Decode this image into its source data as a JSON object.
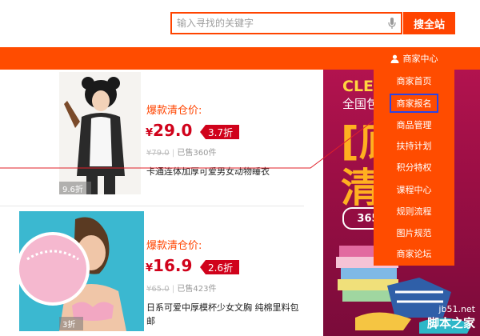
{
  "search": {
    "placeholder": "输入寻找的关键字",
    "button_label": "搜全站"
  },
  "nav": {
    "merchant_center_label": "商家中心",
    "dropdown_items": [
      "商家首页",
      "商家报名",
      "商品管理",
      "扶持计划",
      "积分特权",
      "课程中心",
      "规则流程",
      "图片规范",
      "商家论坛"
    ],
    "highlighted_item": "商家报名"
  },
  "products": [
    {
      "tag": "爆款清仓价:",
      "currency": "¥",
      "price": "29.0",
      "discount": "3.7折",
      "original_price": "¥79.0",
      "sold": "已售360件",
      "title": "卡通连体加厚可爱男女动物睡衣",
      "image_badge": "9.6折"
    },
    {
      "tag": "爆款清仓价:",
      "currency": "¥",
      "price": "16.9",
      "discount": "2.6折",
      "original_price": "¥65.0",
      "sold": "已售423件",
      "title": "日系可爱中厚模杯少女文胸 纯棉里料包邮",
      "image_badge": "3折"
    }
  ],
  "banner": {
    "heading": "CLEA",
    "subheading": "全国包",
    "big_char_1": "[底",
    "big_char_2": "清",
    "badge": "365"
  },
  "watermark": {
    "domain": "jb51.net",
    "name": "脚本之家"
  },
  "colors": {
    "accent": "#ff4c00",
    "price_red": "#d0021b",
    "highlight_border": "#2a44e6"
  }
}
